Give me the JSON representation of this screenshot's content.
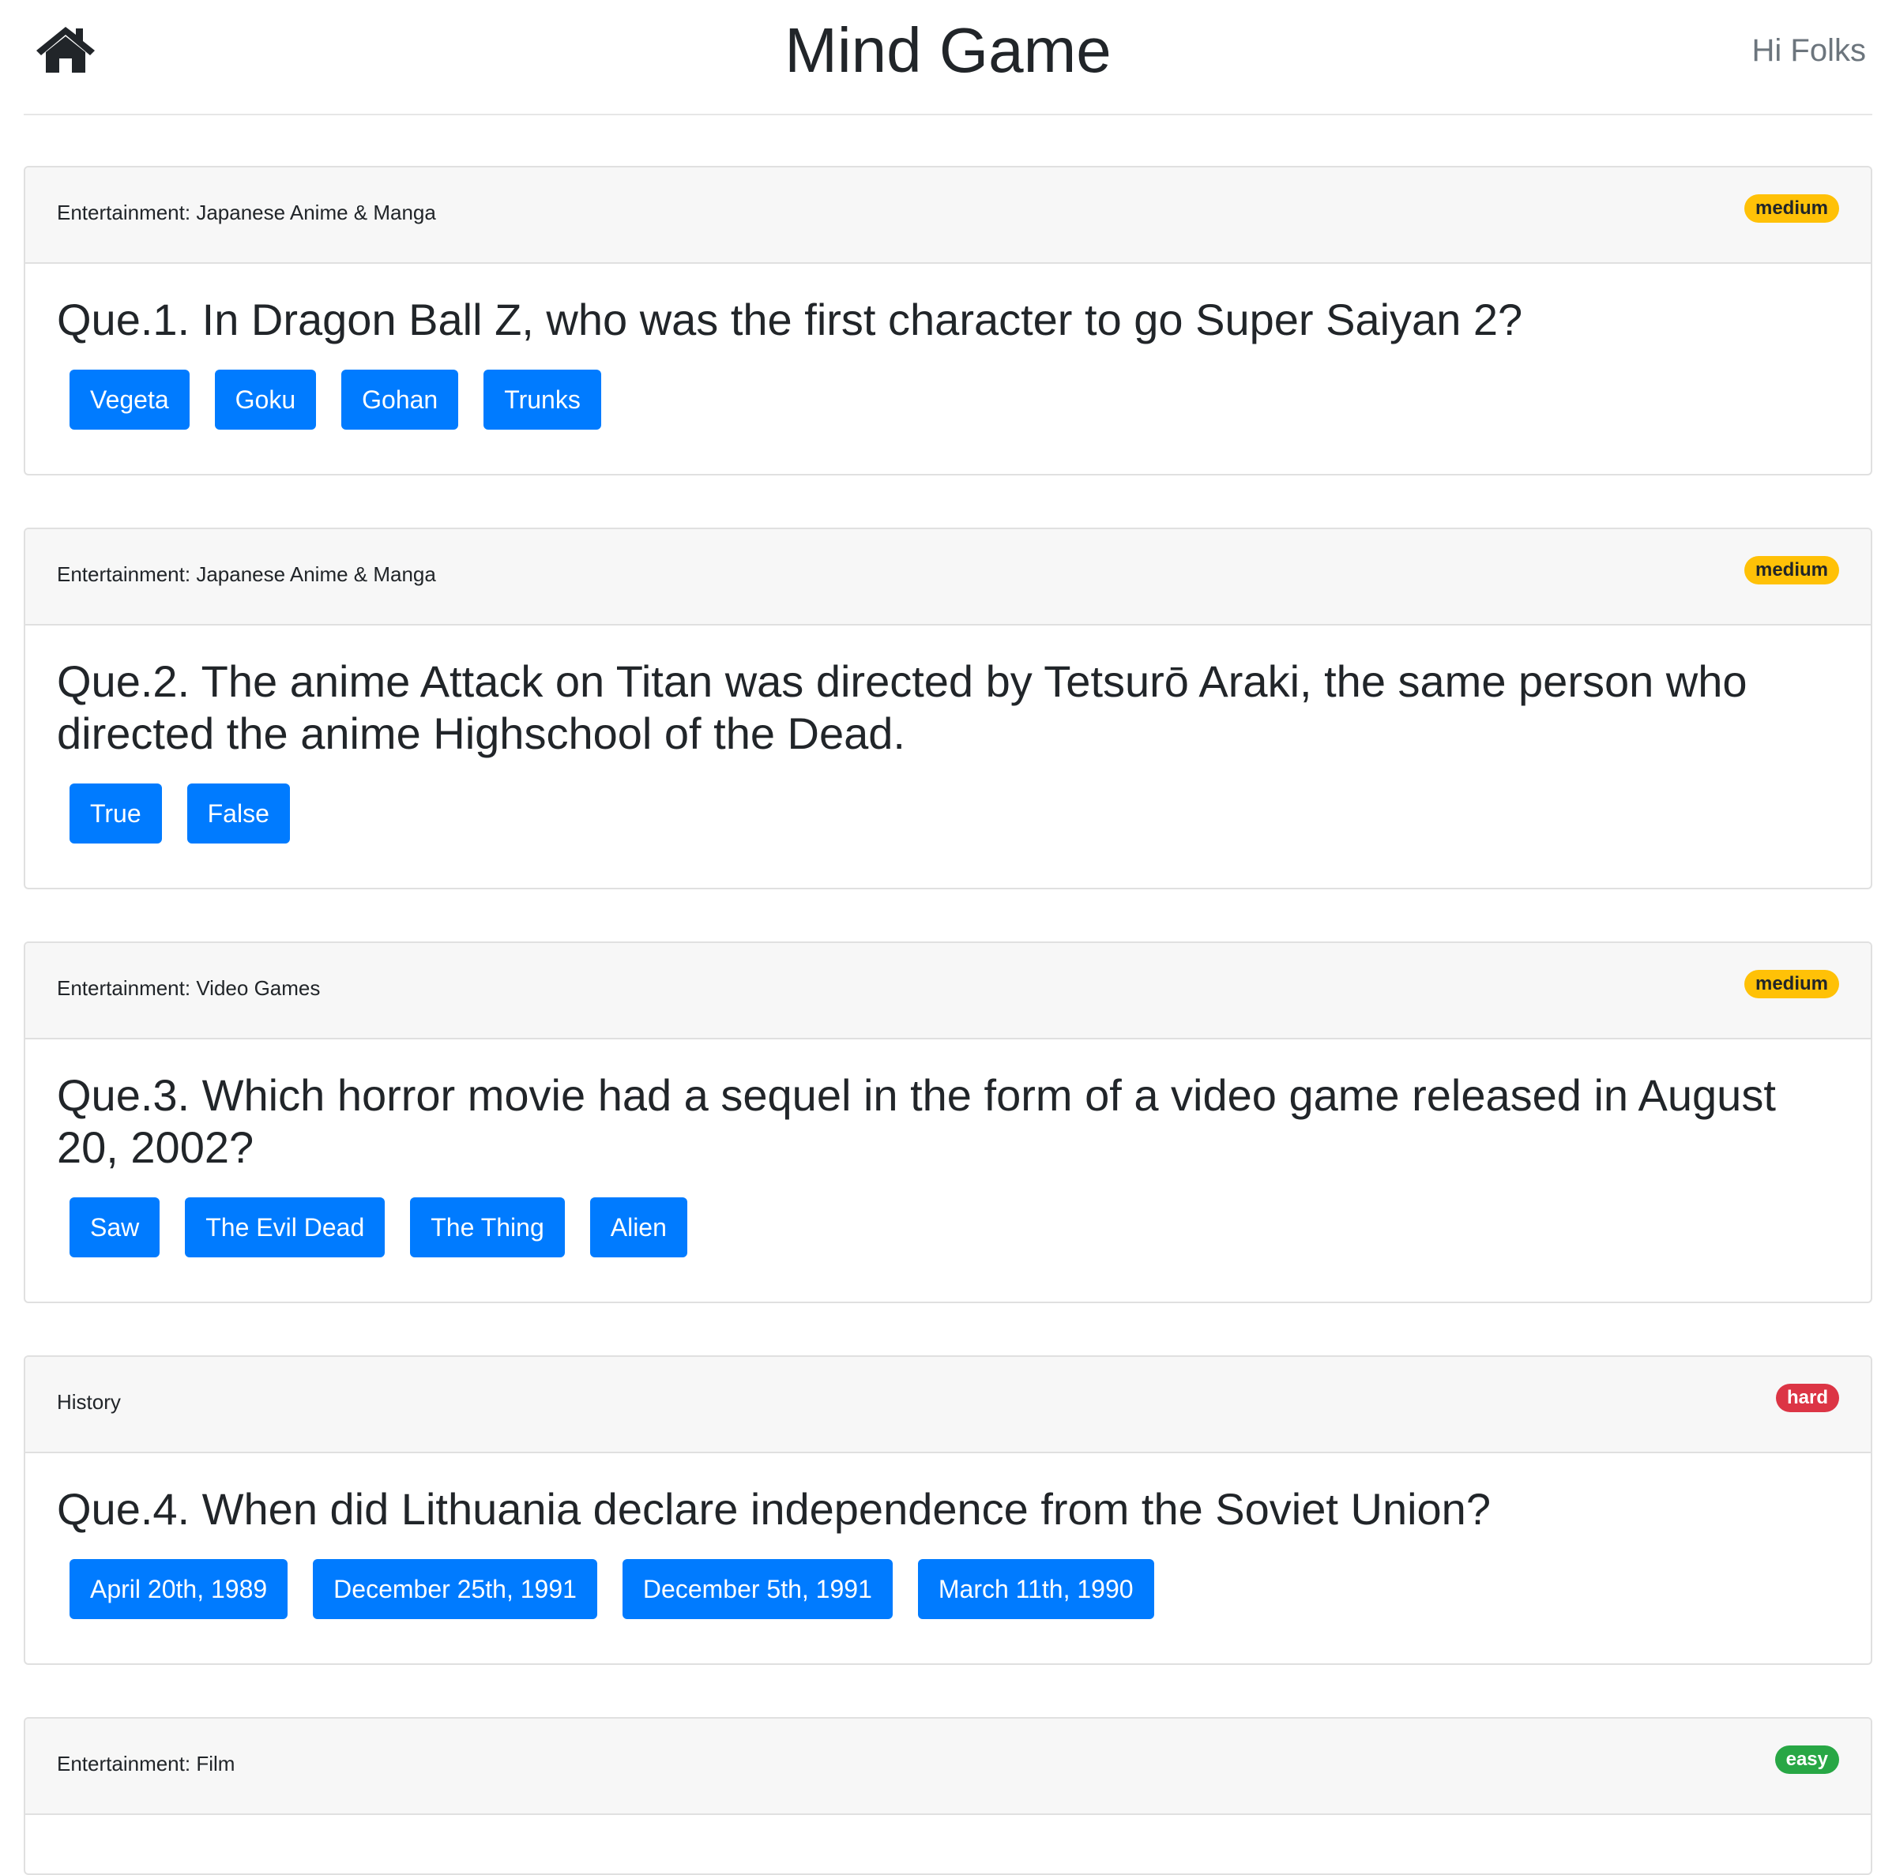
{
  "header": {
    "title": "Mind Game",
    "greeting": "Hi Folks",
    "home_icon": "home-icon"
  },
  "questions": [
    {
      "category": "Entertainment: Japanese Anime & Manga",
      "difficulty": "medium",
      "text": "Que.1. In Dragon Ball Z, who was the first character to go Super Saiyan 2?",
      "answers": [
        "Vegeta",
        "Goku",
        "Gohan",
        "Trunks"
      ]
    },
    {
      "category": "Entertainment: Japanese Anime & Manga",
      "difficulty": "medium",
      "text": "Que.2. The anime Attack on Titan was directed by Tetsurō Araki, the same person who directed the anime Highschool of the Dead.",
      "answers": [
        "True",
        "False"
      ]
    },
    {
      "category": "Entertainment: Video Games",
      "difficulty": "medium",
      "text": "Que.3. Which horror movie had a sequel in the form of a video game released in August 20, 2002?",
      "answers": [
        "Saw",
        "The Evil Dead",
        "The Thing",
        "Alien"
      ]
    },
    {
      "category": "History",
      "difficulty": "hard",
      "text": "Que.4. When did Lithuania declare independence from the Soviet Union?",
      "answers": [
        "April 20th, 1989",
        "December 25th, 1991",
        "December 5th, 1991",
        "March 11th, 1990"
      ]
    },
    {
      "category": "Entertainment: Film",
      "difficulty": "easy"
    }
  ],
  "colors": {
    "primary": "#007bff",
    "medium": "#ffc107",
    "hard": "#dc3545",
    "easy": "#28a745"
  }
}
